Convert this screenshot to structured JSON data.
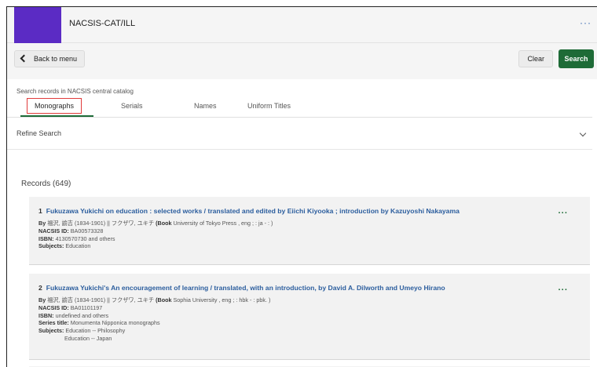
{
  "app": {
    "title": "NACSIS-CAT/ILL",
    "more": "···"
  },
  "toolbar": {
    "back_label": "Back to menu",
    "clear_label": "Clear",
    "search_label": "Search"
  },
  "search_scope": "Search records in NACSIS central catalog",
  "tabs": [
    {
      "label": "Monographs",
      "active": true
    },
    {
      "label": "Serials"
    },
    {
      "label": "Names"
    },
    {
      "label": "Uniform Titles"
    }
  ],
  "refine": {
    "label": "Refine Search"
  },
  "records": {
    "count_label": "Records (649)",
    "items": [
      {
        "num": "1",
        "title": "Fukuzawa Yukichi on education : selected works / translated and edited by Eiichi Kiyooka ; introduction by Kazuyoshi Nakayama",
        "by_label": "By",
        "by_value": "福沢, 諭吉 (1834-1901) || フクザワ, ユキチ",
        "book_label": "(Book",
        "book_value": "University of Tokyo Press , eng ; : ja - : )",
        "nacsis_label": "NACSIS ID:",
        "nacsis_value": "BA00573328",
        "isbn_label": "ISBN:",
        "isbn_value": "4130570730 and others",
        "subjects_label": "Subjects:",
        "subjects_value": "Education",
        "more": "···"
      },
      {
        "num": "2",
        "title": "Fukuzawa Yukichi's An encouragement of learning / translated, with an introduction, by David A. Dilworth and Umeyo Hirano",
        "by_label": "By",
        "by_value": "福沢, 諭吉 (1834-1901) || フクザワ, ユキチ",
        "book_label": "(Book",
        "book_value": "Sophia University , eng ; : hbk - : pbk. )",
        "nacsis_label": "NACSIS ID:",
        "nacsis_value": "BA01101197",
        "isbn_label": "ISBN:",
        "isbn_value": "undefined and others",
        "series_label": "Series title:",
        "series_value": "Monumenta Nipponica monographs",
        "subjects_label": "Subjects:",
        "subjects_value": "Education -- Philosophy",
        "subjects_value_2": "Education -- Japan",
        "more": "···"
      }
    ]
  }
}
